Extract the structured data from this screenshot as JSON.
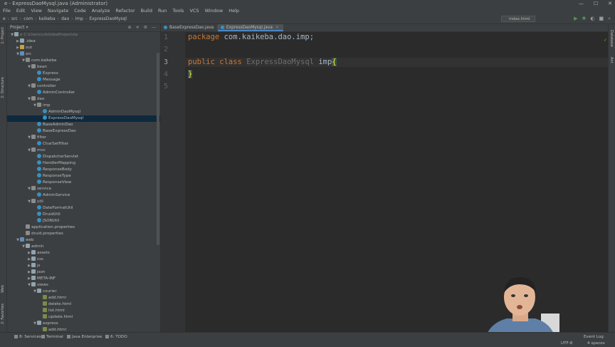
{
  "window": {
    "title": "e - ExpressDaoMysql.java (Administrator)",
    "controls": [
      "—",
      "☐",
      "✕"
    ]
  },
  "menu": [
    "File",
    "Edit",
    "View",
    "Navigate",
    "Code",
    "Analyze",
    "Refactor",
    "Build",
    "Run",
    "Tools",
    "VCS",
    "Window",
    "Help"
  ],
  "breadcrumbs": [
    "e",
    "src",
    "com",
    "kaikeba",
    "dao",
    "imp",
    "ExpressDaoMysql"
  ],
  "run_config": "index.html",
  "project_panel": {
    "title": "Project",
    "tree": [
      {
        "label": "e  C:\\Users\\cds\\IdeaProjects\\e",
        "depth": 0,
        "arrow": "▼",
        "icon": "folder",
        "style": "grey"
      },
      {
        "label": ".idea",
        "depth": 1,
        "arrow": "▶",
        "icon": "folder",
        "style": ""
      },
      {
        "label": "out",
        "depth": 1,
        "arrow": "▶",
        "icon": "folder-orange",
        "style": ""
      },
      {
        "label": "src",
        "depth": 1,
        "arrow": "▼",
        "icon": "folder-blue",
        "style": ""
      },
      {
        "label": "com.kaikeba",
        "depth": 2,
        "arrow": "▼",
        "icon": "pkg",
        "style": ""
      },
      {
        "label": "bean",
        "depth": 3,
        "arrow": "▼",
        "icon": "pkg",
        "style": ""
      },
      {
        "label": "Express",
        "depth": 4,
        "arrow": "",
        "icon": "cls",
        "style": ""
      },
      {
        "label": "Message",
        "depth": 4,
        "arrow": "",
        "icon": "cls",
        "style": ""
      },
      {
        "label": "controller",
        "depth": 3,
        "arrow": "▼",
        "icon": "pkg",
        "style": ""
      },
      {
        "label": "AdminController",
        "depth": 4,
        "arrow": "",
        "icon": "cls",
        "style": ""
      },
      {
        "label": "dao",
        "depth": 3,
        "arrow": "▼",
        "icon": "pkg",
        "style": ""
      },
      {
        "label": "imp",
        "depth": 4,
        "arrow": "▼",
        "icon": "pkg",
        "style": ""
      },
      {
        "label": "AdminDaoMysql",
        "depth": 5,
        "arrow": "",
        "icon": "cls",
        "style": ""
      },
      {
        "label": "ExpressDaoMysql",
        "depth": 5,
        "arrow": "",
        "icon": "cls",
        "style": "sel"
      },
      {
        "label": "BaseAdminDao",
        "depth": 4,
        "arrow": "",
        "icon": "cls",
        "style": ""
      },
      {
        "label": "BaseExpressDao",
        "depth": 4,
        "arrow": "",
        "icon": "cls",
        "style": ""
      },
      {
        "label": "filter",
        "depth": 3,
        "arrow": "▼",
        "icon": "pkg",
        "style": ""
      },
      {
        "label": "CharSetFilter",
        "depth": 4,
        "arrow": "",
        "icon": "cls",
        "style": ""
      },
      {
        "label": "mvc",
        "depth": 3,
        "arrow": "▼",
        "icon": "pkg",
        "style": ""
      },
      {
        "label": "DispatcherServlet",
        "depth": 4,
        "arrow": "",
        "icon": "cls",
        "style": ""
      },
      {
        "label": "HandlerMapping",
        "depth": 4,
        "arrow": "",
        "icon": "cls",
        "style": ""
      },
      {
        "label": "ResponseBody",
        "depth": 4,
        "arrow": "",
        "icon": "cls",
        "style": ""
      },
      {
        "label": "ResponseType",
        "depth": 4,
        "arrow": "",
        "icon": "cls",
        "style": ""
      },
      {
        "label": "ResponseView",
        "depth": 4,
        "arrow": "",
        "icon": "cls",
        "style": ""
      },
      {
        "label": "service",
        "depth": 3,
        "arrow": "▼",
        "icon": "pkg",
        "style": ""
      },
      {
        "label": "AdminService",
        "depth": 4,
        "arrow": "",
        "icon": "cls",
        "style": ""
      },
      {
        "label": "util",
        "depth": 3,
        "arrow": "▼",
        "icon": "pkg",
        "style": ""
      },
      {
        "label": "DateFormatUtil",
        "depth": 4,
        "arrow": "",
        "icon": "cls",
        "style": ""
      },
      {
        "label": "DruidUtil",
        "depth": 4,
        "arrow": "",
        "icon": "cls",
        "style": ""
      },
      {
        "label": "JSONUtil",
        "depth": 4,
        "arrow": "",
        "icon": "cls",
        "style": ""
      },
      {
        "label": "application.properties",
        "depth": 2,
        "arrow": "",
        "icon": "prop",
        "style": ""
      },
      {
        "label": "druid.properties",
        "depth": 2,
        "arrow": "",
        "icon": "prop",
        "style": ""
      },
      {
        "label": "web",
        "depth": 1,
        "arrow": "▼",
        "icon": "folder-blue",
        "style": ""
      },
      {
        "label": "admin",
        "depth": 2,
        "arrow": "▼",
        "icon": "folder",
        "style": ""
      },
      {
        "label": "assets",
        "depth": 3,
        "arrow": "▶",
        "icon": "folder",
        "style": ""
      },
      {
        "label": "css",
        "depth": 3,
        "arrow": "▶",
        "icon": "folder",
        "style": ""
      },
      {
        "label": "js",
        "depth": 3,
        "arrow": "▶",
        "icon": "folder",
        "style": ""
      },
      {
        "label": "json",
        "depth": 3,
        "arrow": "▶",
        "icon": "folder",
        "style": ""
      },
      {
        "label": "META-INF",
        "depth": 3,
        "arrow": "▶",
        "icon": "folder",
        "style": ""
      },
      {
        "label": "views",
        "depth": 3,
        "arrow": "▼",
        "icon": "folder",
        "style": ""
      },
      {
        "label": "courier",
        "depth": 4,
        "arrow": "▼",
        "icon": "folder",
        "style": ""
      },
      {
        "label": "add.html",
        "depth": 5,
        "arrow": "",
        "icon": "file",
        "style": ""
      },
      {
        "label": "delete.html",
        "depth": 5,
        "arrow": "",
        "icon": "file",
        "style": ""
      },
      {
        "label": "list.html",
        "depth": 5,
        "arrow": "",
        "icon": "file",
        "style": ""
      },
      {
        "label": "update.html",
        "depth": 5,
        "arrow": "",
        "icon": "file",
        "style": ""
      },
      {
        "label": "express",
        "depth": 4,
        "arrow": "▼",
        "icon": "folder",
        "style": ""
      },
      {
        "label": "add.html",
        "depth": 5,
        "arrow": "",
        "icon": "file",
        "style": ""
      }
    ]
  },
  "left_strip_tabs": [
    "1: Project",
    "2: Structure",
    "Web",
    "2: Favorites"
  ],
  "right_strip_tabs": [
    "Database",
    "Ant"
  ],
  "editor": {
    "tabs": [
      {
        "label": "BaseExpressDao.java",
        "active": false
      },
      {
        "label": "ExpressDaoMysql.java",
        "active": true
      }
    ],
    "line_numbers": [
      "1",
      "2",
      "3",
      "4",
      "5"
    ],
    "line1": {
      "kw": "package",
      "rest": " com.kaikeba.dao.imp;"
    },
    "line3": {
      "kw1": "public",
      "kw2": "class",
      "name": "ExpressDaoMysql",
      "rest": "imp",
      "brace_open": "{"
    },
    "line4": {
      "brace_close": "}"
    }
  },
  "statusbar": {
    "left": [
      "8: Services",
      "Terminal",
      "Java Enterprise",
      "6: TODO"
    ],
    "right": [
      "Event Log",
      "4 spaces",
      "UTF-8"
    ]
  },
  "colors": {
    "keyword": "#cc7832",
    "selection": "#0d293e",
    "accent": "#4a88c7"
  }
}
